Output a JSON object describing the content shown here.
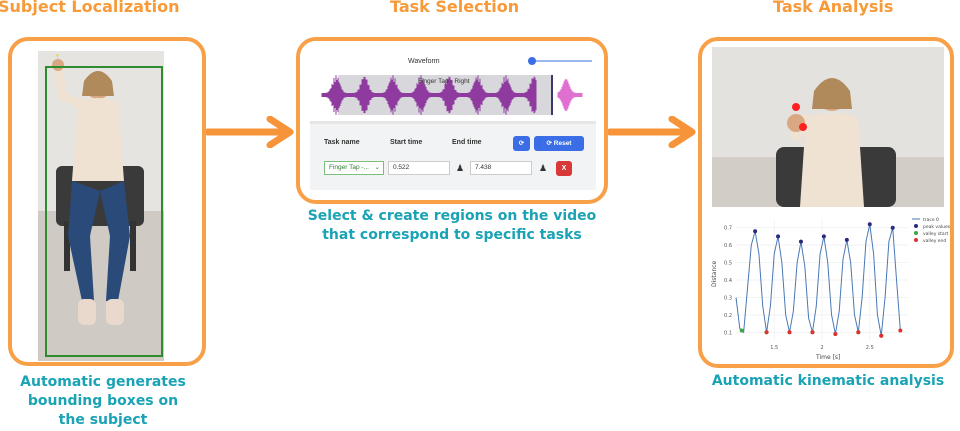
{
  "stages": {
    "subject": {
      "title": "Subject Localization",
      "caption_lines": [
        "Automatic generates",
        "bounding boxes on",
        "the subject"
      ]
    },
    "selection": {
      "title": "Task Selection",
      "caption_lines": [
        "Select & create regions on the video",
        "that correspond to specific tasks"
      ]
    },
    "analysis": {
      "title": "Task Analysis",
      "caption_lines": [
        "Automatic kinematic analysis"
      ]
    }
  },
  "task_panel": {
    "waveform_label": "Waveform",
    "region_label": "Finger Tap - Right",
    "columns": {
      "task_name": "Task name",
      "start_time": "Start time",
      "end_time": "End time"
    },
    "task_select_value": "Finger Tap -...",
    "start_value": "0.522",
    "end_value": "7.438",
    "reset_label": "Reset",
    "delete_label": "X"
  },
  "colors": {
    "accent_orange": "#f7a047",
    "caption_teal": "#1aa2b5",
    "waveform_purple": "#8e3a9f",
    "bbox_green": "#2e8b2e"
  },
  "chart_data": {
    "type": "line",
    "xlabel": "Time [s]",
    "ylabel": "Distance",
    "x_ticks": [
      "1.5",
      "2",
      "2.5"
    ],
    "y_ticks": [
      "0.1",
      "0.2",
      "0.3",
      "0.4",
      "0.5",
      "0.6",
      "0.7"
    ],
    "xlim": [
      1.1,
      2.9
    ],
    "ylim": [
      0.05,
      0.75
    ],
    "legend": [
      "trace 0",
      "peak values",
      "valley start",
      "valley end"
    ],
    "legend_position": "top-right",
    "series": [
      {
        "name": "trace 0",
        "x": [
          1.1,
          1.14,
          1.18,
          1.22,
          1.26,
          1.3,
          1.34,
          1.38,
          1.42,
          1.46,
          1.5,
          1.54,
          1.58,
          1.62,
          1.66,
          1.7,
          1.74,
          1.78,
          1.82,
          1.86,
          1.9,
          1.94,
          1.98,
          2.02,
          2.06,
          2.1,
          2.14,
          2.18,
          2.22,
          2.26,
          2.3,
          2.34,
          2.38,
          2.42,
          2.46,
          2.5,
          2.54,
          2.58,
          2.62,
          2.66,
          2.7,
          2.74,
          2.78,
          2.82
        ],
        "y": [
          0.3,
          0.12,
          0.1,
          0.35,
          0.6,
          0.68,
          0.55,
          0.25,
          0.1,
          0.25,
          0.55,
          0.65,
          0.5,
          0.2,
          0.1,
          0.22,
          0.5,
          0.62,
          0.48,
          0.18,
          0.1,
          0.25,
          0.55,
          0.65,
          0.5,
          0.2,
          0.09,
          0.22,
          0.52,
          0.63,
          0.5,
          0.2,
          0.1,
          0.3,
          0.62,
          0.72,
          0.55,
          0.2,
          0.08,
          0.3,
          0.62,
          0.7,
          0.4,
          0.11
        ]
      },
      {
        "name": "peak values",
        "x": [
          1.3,
          1.54,
          1.78,
          2.02,
          2.26,
          2.5,
          2.74
        ],
        "y": [
          0.68,
          0.65,
          0.62,
          0.65,
          0.63,
          0.72,
          0.7
        ]
      },
      {
        "name": "valley start",
        "x": [
          1.16,
          1.42,
          1.66,
          1.9,
          2.14,
          2.38,
          2.62
        ],
        "y": [
          0.11,
          0.1,
          0.1,
          0.1,
          0.09,
          0.1,
          0.08
        ]
      },
      {
        "name": "valley end",
        "x": [
          1.42,
          1.66,
          1.9,
          2.14,
          2.38,
          2.62,
          2.82
        ],
        "y": [
          0.1,
          0.1,
          0.1,
          0.09,
          0.1,
          0.08,
          0.11
        ]
      }
    ]
  }
}
